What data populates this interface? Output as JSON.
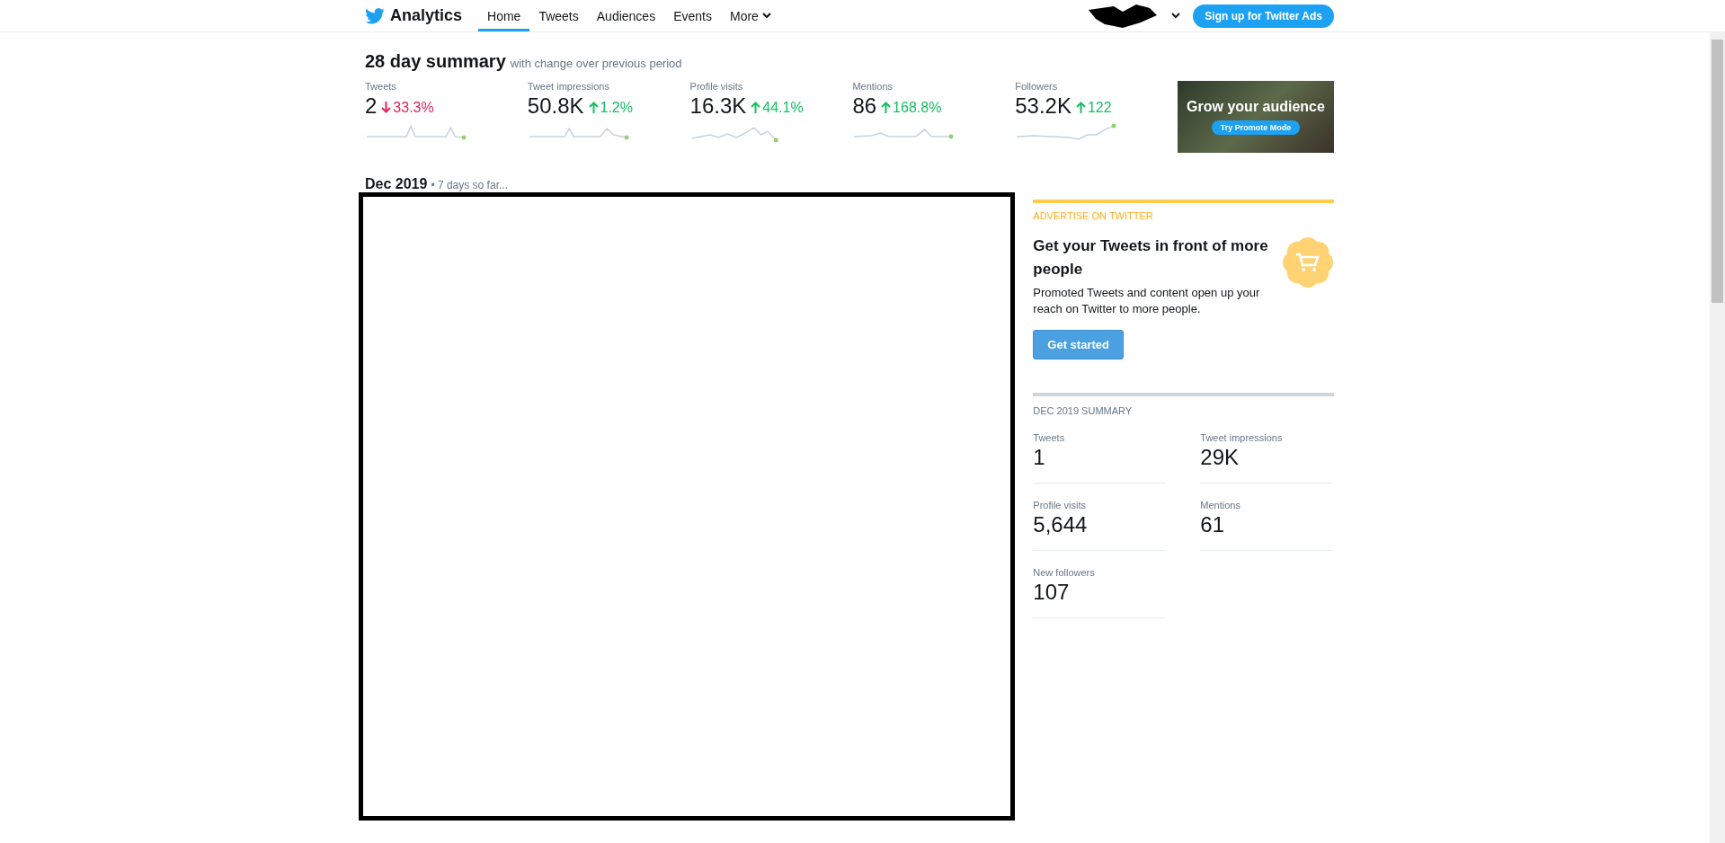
{
  "nav": {
    "brand": "Analytics",
    "tabs": [
      {
        "label": "Home",
        "selected": true
      },
      {
        "label": "Tweets",
        "selected": false
      },
      {
        "label": "Audiences",
        "selected": false
      },
      {
        "label": "Events",
        "selected": false
      },
      {
        "label": "More",
        "selected": false
      }
    ],
    "signup_button": "Sign up for Twitter Ads"
  },
  "summary": {
    "title": "28 day summary",
    "subtitle": "with change over previous period",
    "stats": [
      {
        "label": "Tweets",
        "value": "2",
        "change": "33.3%",
        "kind": "down"
      },
      {
        "label": "Tweet impressions",
        "value": "50.8K",
        "change": "1.2%",
        "kind": "up"
      },
      {
        "label": "Profile visits",
        "value": "16.3K",
        "change": "44.1%",
        "kind": "up"
      },
      {
        "label": "Mentions",
        "value": "86",
        "change": "168.8%",
        "kind": "up"
      },
      {
        "label": "Followers",
        "value": "53.2K",
        "change": "122",
        "kind": "up"
      }
    ],
    "promo": {
      "headline": "Grow your audience",
      "button": "Try Promote Mode"
    }
  },
  "month": {
    "title": "Dec 2019",
    "note": "• 7 days so far..."
  },
  "advertise": {
    "eyebrow": "ADVERTISE ON TWITTER",
    "heading": "Get your Tweets in front of more people",
    "body": "Promoted Tweets and content open up your reach on Twitter to more people.",
    "button": "Get started"
  },
  "month_summary": {
    "title": "DEC 2019 SUMMARY",
    "items": [
      {
        "label": "Tweets",
        "value": "1"
      },
      {
        "label": "Tweet impressions",
        "value": "29K"
      },
      {
        "label": "Profile visits",
        "value": "5,644"
      },
      {
        "label": "Mentions",
        "value": "61"
      },
      {
        "label": "New followers",
        "value": "107"
      }
    ]
  }
}
